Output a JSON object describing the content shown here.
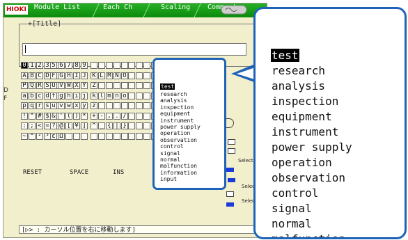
{
  "header": {
    "logo": "HIOKI",
    "tabs": [
      "Module List",
      "Each Ch",
      "Scaling",
      "Comment"
    ],
    "channel_button": "CHAN"
  },
  "title_section": {
    "label": "+[Title]",
    "value": ""
  },
  "keyboard": {
    "rows": [
      [
        [
          "0",
          "1",
          "2",
          "3",
          "4"
        ],
        [
          "5",
          "6",
          "7",
          "8",
          "9"
        ],
        [
          "",
          "",
          "",
          "",
          ""
        ],
        [
          "",
          "",
          "",
          "",
          ""
        ]
      ],
      [
        [
          "A",
          "B",
          "C",
          "D",
          "E"
        ],
        [
          "F",
          "G",
          "H",
          "I",
          "J"
        ],
        [
          "K",
          "L",
          "M",
          "N",
          "O"
        ],
        [
          "",
          "",
          "",
          "",
          ""
        ]
      ],
      [
        [
          "P",
          "Q",
          "R",
          "S",
          "T"
        ],
        [
          "U",
          "V",
          "W",
          "X",
          "Y"
        ],
        [
          "Z",
          "",
          "",
          "",
          ""
        ],
        [
          "",
          "",
          "",
          "",
          ""
        ]
      ],
      [
        [
          "a",
          "b",
          "c",
          "d",
          "e"
        ],
        [
          "f",
          "g",
          "h",
          "i",
          "j"
        ],
        [
          "k",
          "l",
          "m",
          "n",
          "o"
        ],
        [
          "",
          "",
          "",
          "",
          ""
        ]
      ],
      [
        [
          "p",
          "q",
          "r",
          "s",
          "t"
        ],
        [
          "u",
          "v",
          "w",
          "x",
          "y"
        ],
        [
          "z",
          "",
          "",
          "",
          ""
        ],
        [
          "",
          "",
          "",
          "",
          ""
        ]
      ],
      [
        [
          "!",
          "\"",
          "#",
          "$",
          "%"
        ],
        [
          "&",
          "'",
          "(",
          ")",
          "*"
        ],
        [
          "+",
          "-",
          ",",
          ".",
          "/"
        ],
        [
          "",
          "",
          "",
          "",
          ""
        ]
      ],
      [
        [
          ":",
          ";",
          "<",
          "=",
          ">"
        ],
        [
          "?",
          "@",
          "[",
          "¥",
          "]"
        ],
        [
          "^",
          "_",
          "{",
          "|",
          "}"
        ],
        [
          "",
          "",
          "",
          "",
          ""
        ]
      ],
      [
        [
          "~",
          "°",
          "²",
          "³",
          "μ"
        ],
        [
          "ε",
          "Ω",
          "",
          "",
          ""
        ],
        [
          "",
          "",
          "",
          "",
          ""
        ],
        [
          "",
          "",
          "",
          "",
          ""
        ]
      ]
    ],
    "side_letters": [
      "D",
      "F"
    ]
  },
  "bottom_buttons": {
    "reset": "RESET",
    "space": "SPACE",
    "ins": "INS"
  },
  "right_panel": {
    "select_list": "SelectList",
    "select_1": "Selec",
    "select_2": "Selec"
  },
  "status_bar": "[▷> : カーソル位置を右に移動します]",
  "word_list": {
    "items": [
      "test",
      "research",
      "analysis",
      "inspection",
      "equipment",
      "instrument",
      "power supply",
      "operation",
      "observation",
      "control",
      "signal",
      "normal",
      "malfunction",
      "information",
      "input"
    ],
    "selected": "test"
  },
  "zoom_view": {
    "items": [
      "test",
      "research",
      "analysis",
      "inspection",
      "equipment",
      "instrument",
      "power supply",
      "operation",
      "observation",
      "control",
      "signal",
      "normal",
      "malfunction"
    ],
    "selected": "test"
  },
  "colors": {
    "accent": "#1f63b8",
    "topbar": "#12951b",
    "screen_bg": "#f2efcc"
  }
}
